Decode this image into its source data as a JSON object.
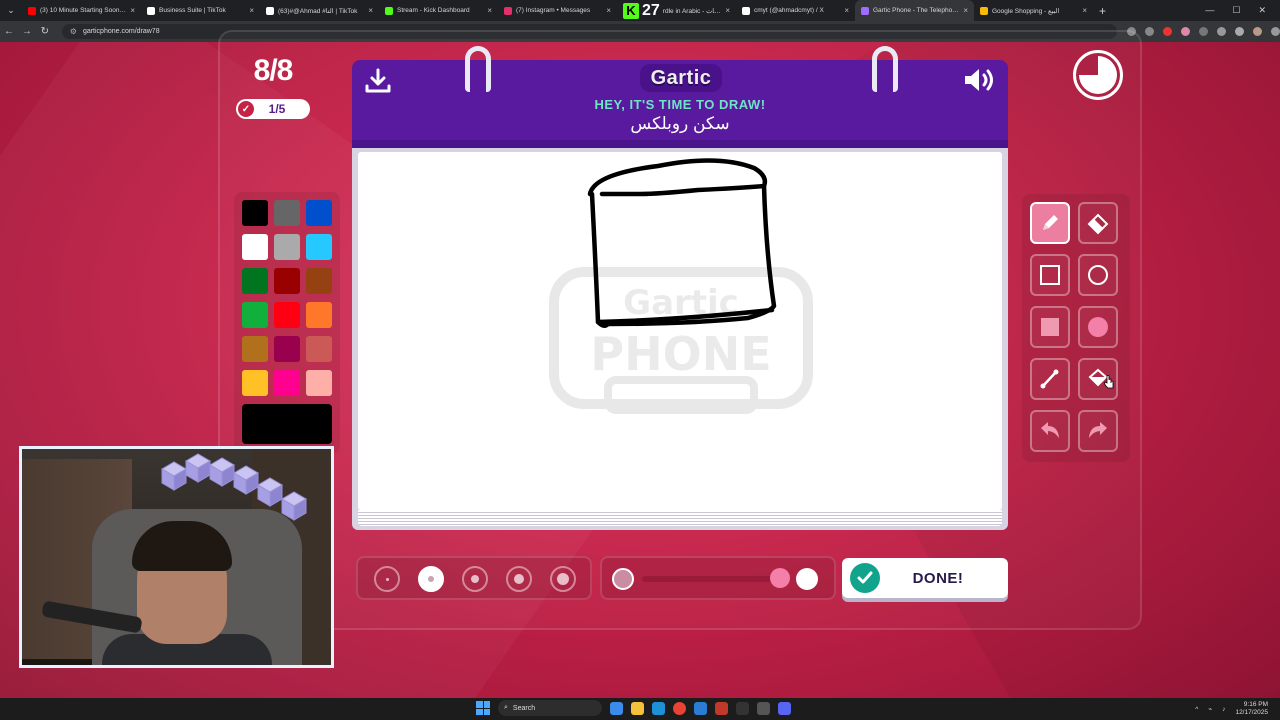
{
  "browser": {
    "tabs": [
      {
        "title": "(3) 10 Minute Starting Soon Sc",
        "favicon_color": "#ff0000",
        "active": false
      },
      {
        "title": "Business Suite | TikTok",
        "favicon_color": "#ffffff",
        "active": false
      },
      {
        "title": "(63)#@Ahmad #التا | TikTok",
        "favicon_color": "#ffffff",
        "active": false
      },
      {
        "title": "Stream - Kick Dashboard",
        "favicon_color": "#53fc18",
        "active": false
      },
      {
        "title": "(7) Instagram • Messages",
        "favicon_color": "#e1306c",
        "active": false
      },
      {
        "title": "rdle in Arabic - كلمات",
        "favicon_color": "#53fc18",
        "active": false,
        "overlay_count": "27"
      },
      {
        "title": "cmyt (@ahmadcmyt) / X",
        "favicon_color": "#ffffff",
        "active": false
      },
      {
        "title": "Gartic Phone - The Telephone G",
        "favicon_color": "#a06cff",
        "active": true
      },
      {
        "title": "Google Shopping - البيع",
        "favicon_color": "#fbbc04",
        "active": false
      }
    ],
    "new_tab": "+",
    "url": "garticphone.com/draw78"
  },
  "game": {
    "round": "8/8",
    "done_count": "1/5",
    "logo": "Gartic",
    "prompt_title": "HEY, IT'S TIME TO DRAW!",
    "prompt_word": "سكن روبلكس",
    "done_label": "DONE!",
    "timer_remaining_fraction": 0.75,
    "palette": [
      "#000000",
      "#666666",
      "#0050cd",
      "#ffffff",
      "#aaaaaa",
      "#26c9ff",
      "#017420",
      "#990000",
      "#964112",
      "#11b03c",
      "#ff0013",
      "#ff7829",
      "#b0701c",
      "#99004e",
      "#cb5a57",
      "#ffc126",
      "#ff008f",
      "#feafa8"
    ],
    "selected_color": "#000000",
    "tools": [
      "pen-tool",
      "eraser-tool",
      "rectangle-outline-tool",
      "ellipse-outline-tool",
      "rectangle-fill-tool",
      "ellipse-fill-tool",
      "line-tool",
      "bucket-tool",
      "undo-tool",
      "redo-tool"
    ],
    "active_tool": "pen-tool",
    "brush_sizes": 5,
    "selected_brush_size": 2
  },
  "taskbar": {
    "search_placeholder": "Search",
    "time": "9:16 PM",
    "date": "12/17/2025"
  }
}
